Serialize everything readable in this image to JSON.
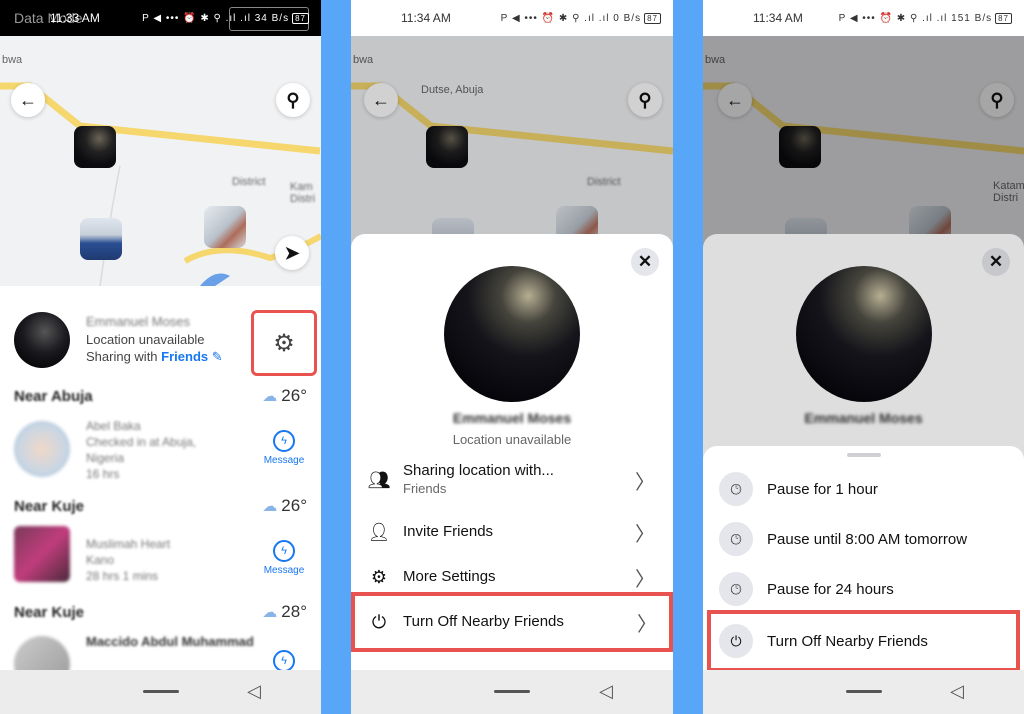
{
  "panels": {
    "p1": {
      "status": {
        "overlay": "Data Mode",
        "time": "11:33 AM",
        "icons": "P ◀ ••• ⏰ ✱ ⚲ .ıl .ıl 34 B/s",
        "battery": "87"
      },
      "map": {
        "labels": [
          "bwa",
          "District",
          "Kam Distri"
        ]
      },
      "me": {
        "name": "Emmanuel Moses",
        "location": "Location unavailable",
        "sharing_prefix": "Sharing with",
        "sharing_audience": "Friends"
      },
      "sections": [
        {
          "title": "Near Abuja",
          "temp": "26°",
          "friends": [
            {
              "name": "Abel Baka",
              "lines": [
                "Checked in at Abuja,",
                "Nigeria",
                "16 hrs"
              ],
              "action": "Message"
            }
          ]
        },
        {
          "title": "Near Kuje",
          "temp": "26°",
          "friends": [
            {
              "name": "Muslimah Heart",
              "lines": [
                "Kano",
                "28 hrs 1 mins"
              ],
              "action": "Message"
            }
          ]
        },
        {
          "title": "Near Kuje",
          "temp": "28°",
          "friends": [
            {
              "name": "Maccido Abdul Muhammad",
              "lines": [],
              "action": "Message"
            }
          ]
        }
      ]
    },
    "p2": {
      "status": {
        "time": "11:34 AM",
        "icons": "P ◀ ••• ⏰ ✱ ⚲ .ıl .ıl 0 B/s",
        "battery": "87"
      },
      "map": {
        "labels": [
          "bwa",
          "Dutse, Abuja",
          "District"
        ]
      },
      "profile": {
        "name": "Emmanuel Moses",
        "location": "Location unavailable"
      },
      "menu": [
        {
          "label": "Sharing location with...",
          "sub": "Friends",
          "icon": "people-icon"
        },
        {
          "label": "Invite Friends",
          "sub": "",
          "icon": "add-person-icon"
        },
        {
          "label": "More Settings",
          "sub": "",
          "icon": "gear-icon"
        },
        {
          "label": "Turn Off Nearby Friends",
          "sub": "",
          "icon": "power-icon"
        }
      ]
    },
    "p3": {
      "status": {
        "time": "11:34 AM",
        "icons": "P ◀ ••• ⏰ ✱ ⚲ .ıl .ıl 151 B/s",
        "battery": "87"
      },
      "map": {
        "labels": [
          "bwa",
          "Katam Distri"
        ]
      },
      "profile": {
        "name": "Emmanuel Moses",
        "location": "Location unavailable"
      },
      "options": [
        {
          "label": "Pause for 1 hour",
          "icon": "clock-icon"
        },
        {
          "label": "Pause until 8:00 AM tomorrow",
          "icon": "clock-icon"
        },
        {
          "label": "Pause for 24 hours",
          "icon": "clock-icon"
        },
        {
          "label": "Turn Off Nearby Friends",
          "icon": "power-icon"
        }
      ]
    }
  },
  "colors": {
    "separator": "#58a6f7",
    "highlight": "#e8524f",
    "accent": "#1877f2"
  }
}
